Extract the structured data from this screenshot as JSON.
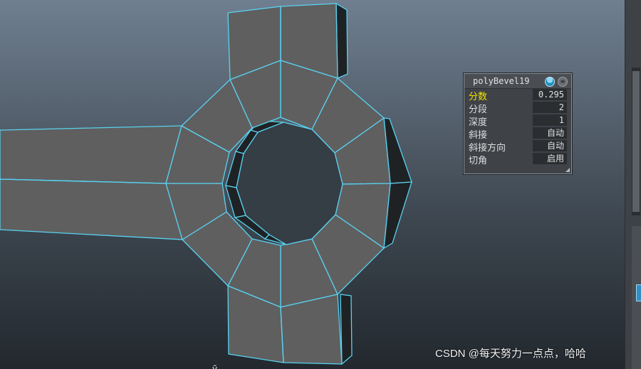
{
  "channel_box": {
    "title": "polyBevel19",
    "rows": [
      {
        "label": "分数",
        "value": "0.295",
        "active": true
      },
      {
        "label": "分段",
        "value": "2"
      },
      {
        "label": "深度",
        "value": "1"
      },
      {
        "label": "斜接",
        "value": "自动"
      },
      {
        "label": "斜接方向",
        "value": "自动"
      },
      {
        "label": "切角",
        "value": "启用"
      }
    ]
  },
  "viewport": {
    "wire_color": "#59d2f0",
    "face_color": "#5f5f60",
    "shadow_face_color": "#1f2224"
  },
  "watermark": {
    "text": "CSDN @每天努力一点点，哈哈"
  },
  "icons": [
    "channel-box-color-icon",
    "channel-box-options-icon",
    "resize-grip-icon"
  ]
}
